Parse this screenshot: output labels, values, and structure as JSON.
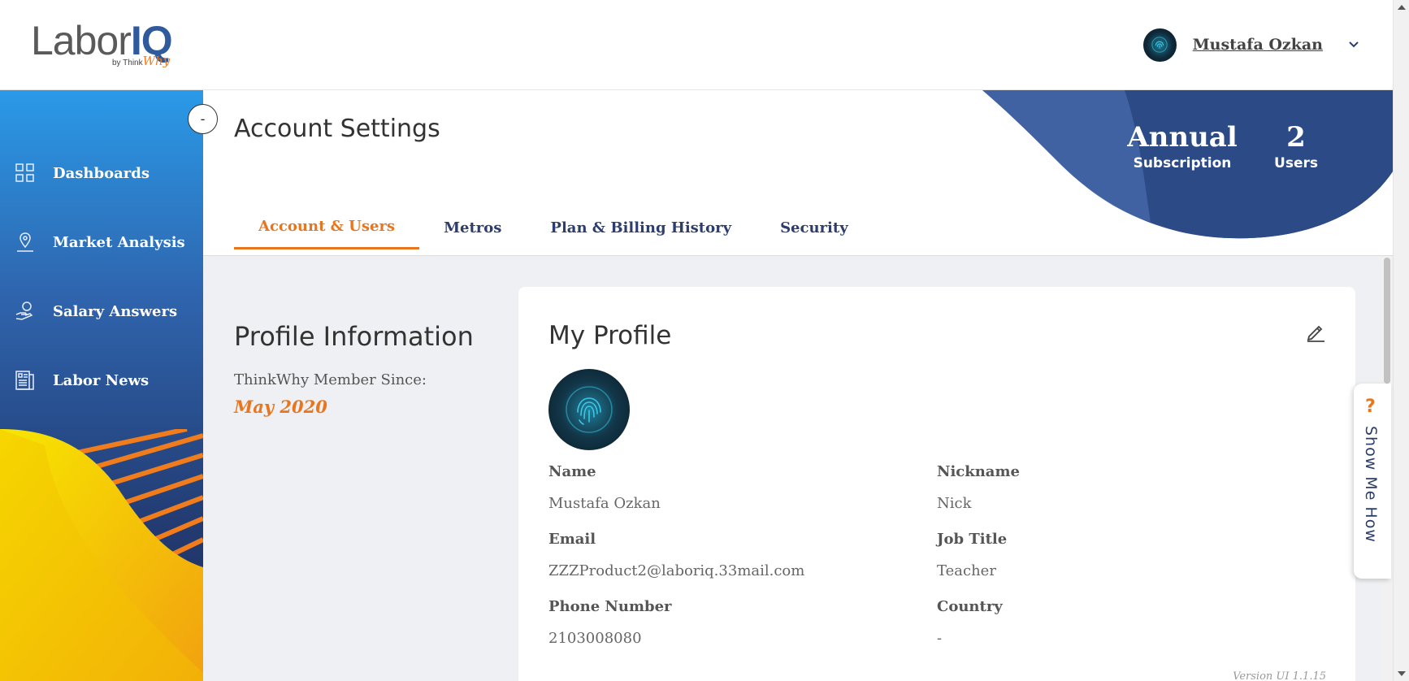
{
  "header": {
    "logo_main": "Labor",
    "logo_accent": "IQ",
    "logo_by": "by Think",
    "logo_by_accent": "Why",
    "user_name": "Mustafa Ozkan"
  },
  "sidebar": {
    "collapse_label": "-",
    "items": [
      {
        "label": "Dashboards",
        "icon": "grid-icon"
      },
      {
        "label": "Market Analysis",
        "icon": "map-pin-icon"
      },
      {
        "label": "Salary Answers",
        "icon": "money-hand-icon"
      },
      {
        "label": "Labor News",
        "icon": "newspaper-icon"
      }
    ]
  },
  "page": {
    "title": "Account Settings",
    "tabs": [
      {
        "label": "Account & Users",
        "active": true
      },
      {
        "label": "Metros",
        "active": false
      },
      {
        "label": "Plan & Billing History",
        "active": false
      },
      {
        "label": "Security",
        "active": false
      }
    ],
    "subscription": {
      "value": "Annual",
      "label": "Subscription"
    },
    "users": {
      "value": "2",
      "label": "Users"
    }
  },
  "profile_info": {
    "title": "Profile Information",
    "member_label": "ThinkWhy Member Since:",
    "member_date": "May 2020"
  },
  "my_profile": {
    "title": "My Profile",
    "fields": {
      "name": {
        "label": "Name",
        "value": "Mustafa Ozkan"
      },
      "nickname": {
        "label": "Nickname",
        "value": "Nick"
      },
      "email": {
        "label": "Email",
        "value": "ZZZProduct2@laboriq.33mail.com"
      },
      "job_title": {
        "label": "Job Title",
        "value": "Teacher"
      },
      "phone": {
        "label": "Phone Number",
        "value": "2103008080"
      },
      "country": {
        "label": "Country",
        "value": "-"
      }
    },
    "version": "Version UI 1.1.15"
  },
  "show_me_how": {
    "icon": "?",
    "label": "Show Me How"
  },
  "colors": {
    "accent_orange": "#e8761f",
    "navy": "#2d3e6e",
    "sidebar_top": "#2a9ae8",
    "sidebar_bottom": "#1e2f5e"
  }
}
